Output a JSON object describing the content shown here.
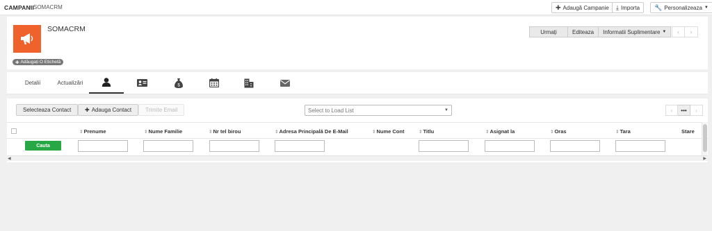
{
  "breadcrumb": {
    "root": "CAMPANII",
    "separator": ">",
    "current": "SOMACRM"
  },
  "topbar": {
    "add_campaign": "Adaugă Campanie",
    "import": "Importa",
    "personalize": "Personalizeaza"
  },
  "record": {
    "title": "SOMACRM",
    "add_tag": "Adăugați O Etichetă",
    "logo_color": "#f0622b",
    "actions": {
      "follow": "Urmați",
      "edit": "Editeaza",
      "more_info": "Informatii Suplimentare"
    }
  },
  "tabs": [
    {
      "label": "Detalii"
    },
    {
      "label": "Actualizări"
    },
    {
      "icon": "contact-person-icon"
    },
    {
      "icon": "id-card-icon"
    },
    {
      "icon": "money-bag-icon"
    },
    {
      "icon": "calendar-icon"
    },
    {
      "icon": "building-icon"
    },
    {
      "icon": "envelope-icon"
    }
  ],
  "list": {
    "select_contact": "Selecteaza Contact",
    "add_contact": "Adauga Contact",
    "send_email": "Trimite Email",
    "load_list_placeholder": "Select to Load List",
    "pager_middle": "•••",
    "columns": [
      "Prenume",
      "Nume Familie",
      "Nr tel birou",
      "Adresa Principală De E-Mail",
      "Nume Cont",
      "Titlu",
      "Asignat la",
      "Oras",
      "Tara",
      "Stare"
    ],
    "search_button": "Cauta",
    "search_button_color": "#27a844"
  }
}
